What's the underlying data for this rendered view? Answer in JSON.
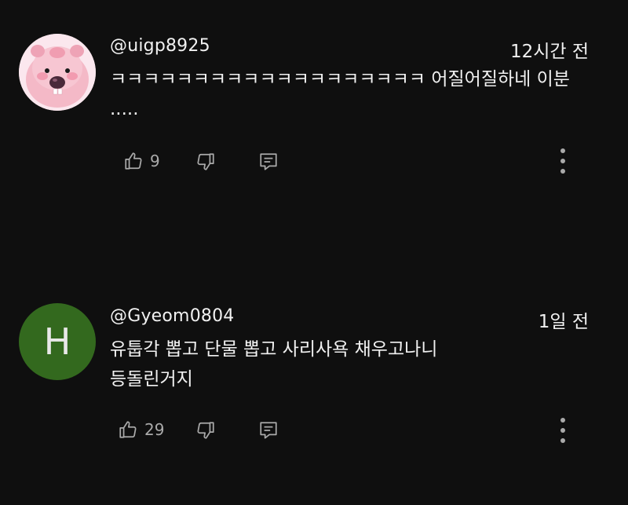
{
  "comments": [
    {
      "author": "@uigp8925",
      "time": "12시간 전",
      "text": "ㅋㅋㅋㅋㅋㅋㅋㅋㅋㅋㅋㅋㅋㅋㅋㅋㅋㅋㅋ 어질어질하네 이분 .....",
      "likes": "9",
      "avatar_icon": "beaver-character-avatar"
    },
    {
      "author": "@Gyeom0804",
      "time": "1일 전",
      "text": "유툽각 뽑고 단물 뽑고 사리사욕 채우고나니 등돌린거지",
      "likes": "29",
      "avatar_letter": "H",
      "avatar_color": "#33691e"
    }
  ],
  "icons": {
    "like": "thumbs-up-icon",
    "dislike": "thumbs-down-icon",
    "reply": "reply-comment-icon",
    "more": "more-vertical-icon"
  },
  "colors": {
    "background": "#0f0f0f",
    "text": "#f1f1f1",
    "secondary": "#aaaaaa"
  }
}
